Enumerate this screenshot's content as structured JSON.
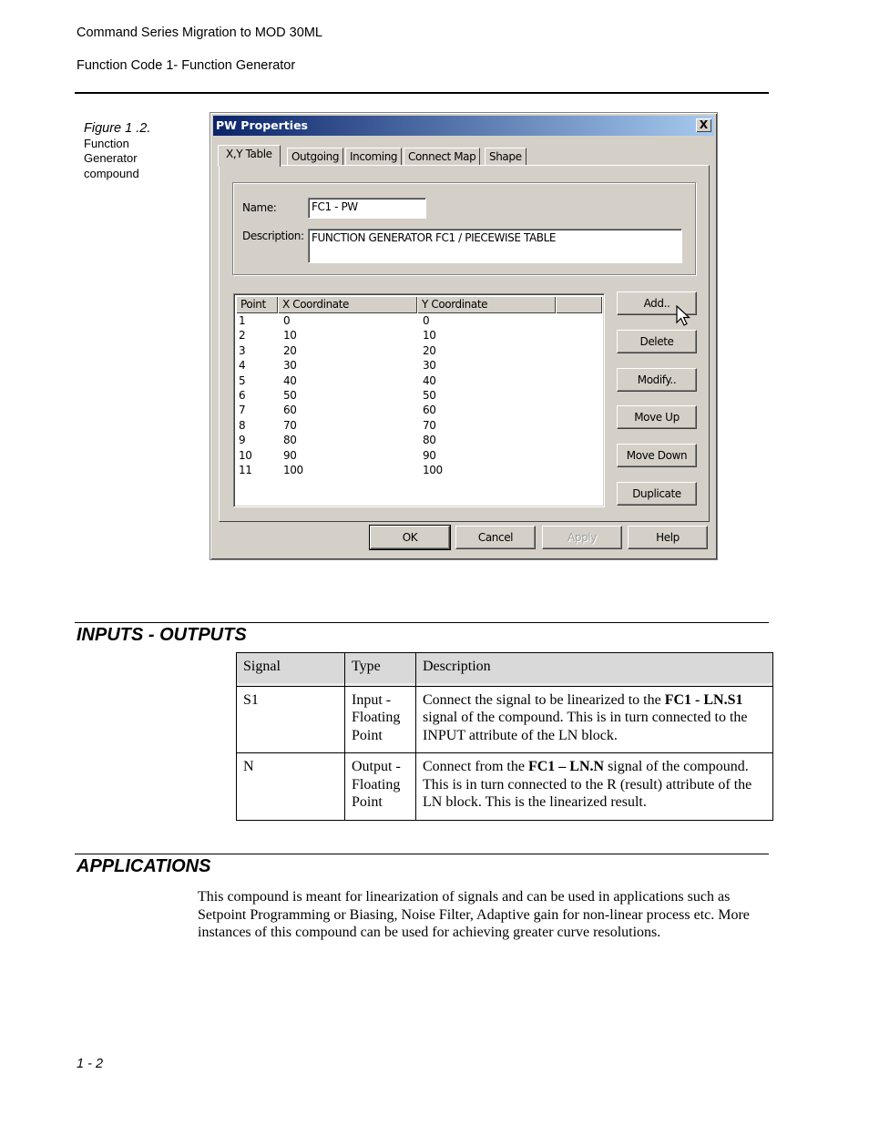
{
  "header": {
    "doc_title": "Command Series Migration to MOD 30ML",
    "section": "Function Code 1- Function Generator"
  },
  "figure": {
    "number": "Figure 1 .2.",
    "caption_lines": [
      "Function",
      "Generator",
      "compound"
    ]
  },
  "dialog": {
    "title": "PW Properties",
    "close_label": "X",
    "tabs": [
      {
        "label": "X,Y Table",
        "active": true
      },
      {
        "label": "Outgoing",
        "active": false
      },
      {
        "label": "Incoming",
        "active": false
      },
      {
        "label": "Connect Map",
        "active": false
      },
      {
        "label": "Shape",
        "active": false
      }
    ],
    "name_label": "Name:",
    "name_value": "FC1 - PW",
    "description_label": "Description:",
    "description_value": "FUNCTION GENERATOR FC1 / PIECEWISE TABLE",
    "list": {
      "columns": [
        "Point",
        "X Coordinate",
        "Y Coordinate",
        ""
      ],
      "rows": [
        [
          "1",
          "0",
          "0"
        ],
        [
          "2",
          "10",
          "10"
        ],
        [
          "3",
          "20",
          "20"
        ],
        [
          "4",
          "30",
          "30"
        ],
        [
          "5",
          "40",
          "40"
        ],
        [
          "6",
          "50",
          "50"
        ],
        [
          "7",
          "60",
          "60"
        ],
        [
          "8",
          "70",
          "70"
        ],
        [
          "9",
          "80",
          "80"
        ],
        [
          "10",
          "90",
          "90"
        ],
        [
          "11",
          "100",
          "100"
        ]
      ]
    },
    "side_buttons": [
      "Add..",
      "Delete",
      "Modify..",
      "Move Up",
      "Move Down",
      "Duplicate"
    ],
    "footer_buttons": [
      {
        "label": "OK",
        "enabled": true
      },
      {
        "label": "Cancel",
        "enabled": true
      },
      {
        "label": "Apply",
        "enabled": false
      },
      {
        "label": "Help",
        "enabled": true
      }
    ]
  },
  "inputs_outputs": {
    "title": "INPUTS - OUTPUTS",
    "headers": [
      "Signal",
      "Type",
      "Description"
    ],
    "rows": [
      {
        "signal": "S1",
        "type_lines": [
          "Input -",
          "Floating",
          "Point"
        ],
        "desc_pre": "Connect the signal to be linearized to the ",
        "desc_bold": "FC1 - LN.S1",
        "desc_post": " signal of the compound. This is in turn connected to the INPUT attribute of the LN block."
      },
      {
        "signal": "N",
        "type_lines": [
          "Output -",
          "Floating",
          "Point"
        ],
        "desc_pre": "Connect from the ",
        "desc_bold": "FC1 – LN.N",
        "desc_post": " signal of the compound. This is in turn connected to the R (result) attribute of the LN block. This is the linearized result."
      }
    ]
  },
  "applications": {
    "title": "APPLICATIONS",
    "text": "This compound is meant for linearization of signals and can be used in applications such as Setpoint Programming or Biasing, Noise Filter, Adaptive gain for non-linear process etc. More instances of this compound can be used for achieving greater curve resolutions."
  },
  "footer": {
    "page_number": "1 - 2"
  }
}
